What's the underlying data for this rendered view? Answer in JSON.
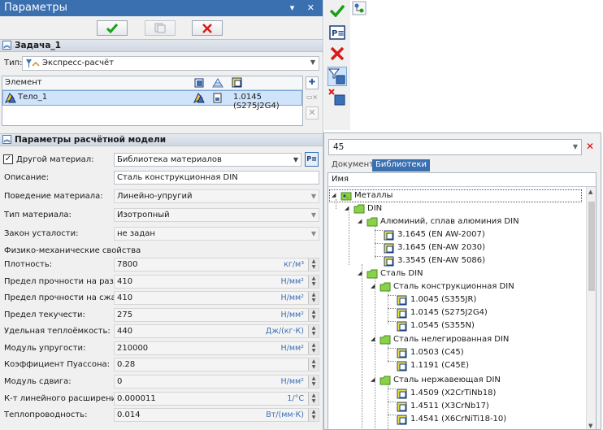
{
  "panel": {
    "title": "Параметры",
    "titlebar_buttons": "ꟷ ✕",
    "toolbar": {
      "ok": "✔",
      "preview": "⎘",
      "cancel": "✖"
    }
  },
  "task": {
    "header": "Задача_1",
    "type_label": "Тип:",
    "type_value": "Экспресс-расчёт",
    "grid_header": "Элемент",
    "row": {
      "name": "Тело_1",
      "material": "1.0145 (S275J2G4)"
    }
  },
  "model": {
    "header": "Параметры расчётной модели",
    "other_material_label": "Другой материал:",
    "other_material_value": "Библиотека материалов",
    "fields": [
      {
        "label": "Описание:",
        "value": "Сталь конструкционная DIN"
      },
      {
        "label": "Поведение материала:",
        "value": "Линейно-упругий"
      },
      {
        "label": "Тип материала:",
        "value": "Изотропный"
      },
      {
        "label": "Закон усталости:",
        "value": "не задан"
      }
    ],
    "physics_header": "Физико-механические свойства",
    "props": [
      {
        "label": "Плотность:",
        "value": "7800",
        "unit": "кг/м³"
      },
      {
        "label": "Предел прочности на разрыв:",
        "value": "410",
        "unit": "Н/мм²"
      },
      {
        "label": "Предел прочности на сжатие:",
        "value": "410",
        "unit": "Н/мм²"
      },
      {
        "label": "Предел текучести:",
        "value": "275",
        "unit": "Н/мм²"
      },
      {
        "label": "Удельная теплоёмкость:",
        "value": "440",
        "unit": "Дж/(кг·К)"
      },
      {
        "label": "Модуль упругости:",
        "value": "210000",
        "unit": "Н/мм²"
      },
      {
        "label": "Коэффициент Пуассона:",
        "value": "0.28",
        "unit": ""
      },
      {
        "label": "Модуль сдвига:",
        "value": "0",
        "unit": "Н/мм²"
      },
      {
        "label": "К-т линейного расширения:",
        "value": "0.000011",
        "unit": "1/°С"
      },
      {
        "label": "Теплопроводность:",
        "value": "0.014",
        "unit": "Вт/(мм·К)"
      }
    ]
  },
  "browser": {
    "search_value": "45",
    "tabs": [
      "Документ",
      "Библиотеки"
    ],
    "tree_header": "Имя",
    "tree": {
      "root": "Металлы",
      "din": "DIN",
      "alu_group": "Алюминий, сплав алюминия DIN",
      "alu": [
        "3.1645 (EN AW-2007)",
        "3.1645 (EN-AW 2030)",
        "3.3545 (EN-AW 5086)"
      ],
      "steel": "Сталь DIN",
      "struct_group": "Сталь конструкционная DIN",
      "struct": [
        "1.0045 (S355JR)",
        "1.0145 (S275J2G4)",
        "1.0545 (S355N)"
      ],
      "unalloyed_group": "Сталь нелегированная DIN",
      "unalloyed": [
        "1.0503 (C45)",
        "1.1191 (C45E)"
      ],
      "stainless_group": "Сталь нержавеющая DIN",
      "stainless": [
        "1.4509 (X2CrTiNb18)",
        "1.4511 (X3CrNb17)",
        "1.4541 (X6CrNiTi18-10)"
      ]
    }
  },
  "colors": {
    "titlebar": "#3a6fb0",
    "accent": "#3c6fb4",
    "ok": "#1aa01a",
    "cancel": "#d81a1a",
    "selection": "#cfe4fa"
  }
}
